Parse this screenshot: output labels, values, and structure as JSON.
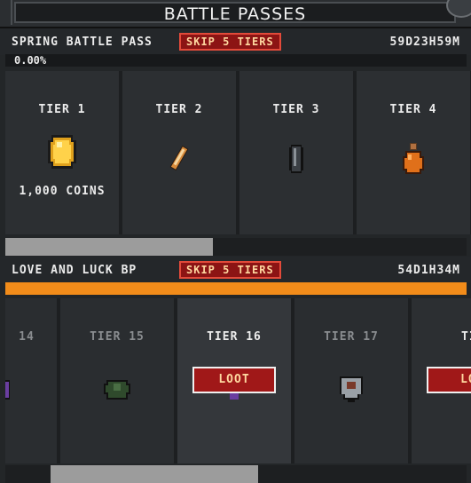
{
  "window": {
    "title": "BATTLE PASSES"
  },
  "passes": [
    {
      "name": "SPRING BATTLE PASS",
      "skip_label": "SKIP 5 TIERS",
      "timer": "59D23H59M",
      "progress_label": "0.00%",
      "progress_fraction": 0.0,
      "tiers": [
        {
          "label": "TIER 1",
          "reward": "1,000 COINS",
          "icon": "coin-icon"
        },
        {
          "label": "TIER 2",
          "reward": "",
          "icon": "scroll-icon"
        },
        {
          "label": "TIER 3",
          "reward": "",
          "icon": "stone-icon"
        },
        {
          "label": "TIER 4",
          "reward": "",
          "icon": "potion-icon"
        }
      ]
    },
    {
      "name": "LOVE AND LUCK BP",
      "skip_label": "SKIP 5 TIERS",
      "timer": "54D1H34M",
      "progress_fraction": 1.0,
      "tiers": [
        {
          "label": "14",
          "icon": "gem-icon"
        },
        {
          "label": "TIER 15",
          "icon": "armor-icon"
        },
        {
          "label": "TIER 16",
          "loot_label": "LOOT",
          "icon": "ring-icon"
        },
        {
          "label": "TIER 17",
          "icon": "shield-icon"
        },
        {
          "label": "TIER",
          "loot_label": "LO",
          "icon": "item-icon"
        }
      ]
    }
  ],
  "colors": {
    "accent_orange": "#f28c1a",
    "button_red": "#a01818",
    "button_border": "#e24a3a"
  }
}
